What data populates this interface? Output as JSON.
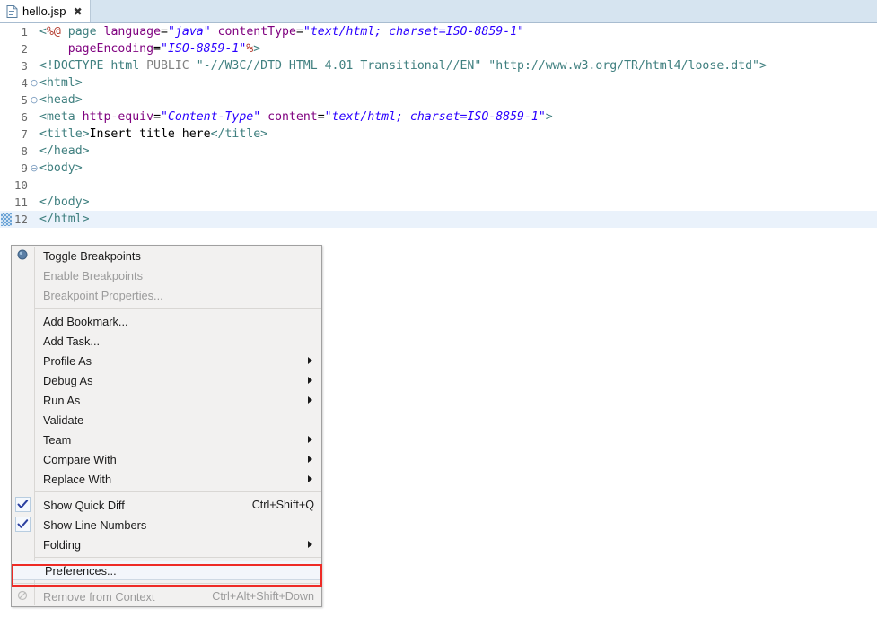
{
  "tab": {
    "filename": "hello.jsp",
    "close_glyph": "✖",
    "icon": "jsp-file-icon"
  },
  "editor": {
    "lines": [
      {
        "number": "1",
        "fold": "",
        "current": false,
        "marker": false,
        "text": "<%@ page language=\"java\" contentType=\"text/html; charset=ISO-8859-1\""
      },
      {
        "number": "2",
        "fold": "",
        "current": false,
        "marker": false,
        "text": "    pageEncoding=\"ISO-8859-1\"%>"
      },
      {
        "number": "3",
        "fold": "",
        "current": false,
        "marker": false,
        "text": "<!DOCTYPE html PUBLIC \"-//W3C//DTD HTML 4.01 Transitional//EN\" \"http://www.w3.org/TR/html4/loose.dtd\">"
      },
      {
        "number": "4",
        "fold": "⊖",
        "current": false,
        "marker": false,
        "text": "<html>"
      },
      {
        "number": "5",
        "fold": "⊖",
        "current": false,
        "marker": false,
        "text": "<head>"
      },
      {
        "number": "6",
        "fold": "",
        "current": false,
        "marker": false,
        "text": "<meta http-equiv=\"Content-Type\" content=\"text/html; charset=ISO-8859-1\">"
      },
      {
        "number": "7",
        "fold": "",
        "current": false,
        "marker": false,
        "text": "<title>Insert title here</title>"
      },
      {
        "number": "8",
        "fold": "",
        "current": false,
        "marker": false,
        "text": "</head>"
      },
      {
        "number": "9",
        "fold": "⊖",
        "current": false,
        "marker": false,
        "text": "<body>"
      },
      {
        "number": "10",
        "fold": "",
        "current": false,
        "marker": false,
        "text": ""
      },
      {
        "number": "11",
        "fold": "",
        "current": false,
        "marker": false,
        "text": "</body>"
      },
      {
        "number": "12",
        "fold": "",
        "current": true,
        "marker": true,
        "text": "</html>"
      }
    ]
  },
  "context_menu": {
    "items": [
      {
        "label": "Toggle Breakpoints",
        "accel": "",
        "type": "icon",
        "icon": "breakpoint-icon",
        "disabled": false,
        "submenu": false
      },
      {
        "label": "Enable Breakpoints",
        "accel": "",
        "type": "plain",
        "icon": "",
        "disabled": true,
        "submenu": false
      },
      {
        "label": "Breakpoint Properties...",
        "accel": "",
        "type": "plain",
        "icon": "",
        "disabled": true,
        "submenu": false
      },
      {
        "type": "separator"
      },
      {
        "label": "Add Bookmark...",
        "accel": "",
        "type": "plain",
        "icon": "",
        "disabled": false,
        "submenu": false
      },
      {
        "label": "Add Task...",
        "accel": "",
        "type": "plain",
        "icon": "",
        "disabled": false,
        "submenu": false
      },
      {
        "label": "Profile As",
        "accel": "",
        "type": "plain",
        "icon": "",
        "disabled": false,
        "submenu": true
      },
      {
        "label": "Debug As",
        "accel": "",
        "type": "plain",
        "icon": "",
        "disabled": false,
        "submenu": true
      },
      {
        "label": "Run As",
        "accel": "",
        "type": "plain",
        "icon": "",
        "disabled": false,
        "submenu": true
      },
      {
        "label": "Validate",
        "accel": "",
        "type": "plain",
        "icon": "",
        "disabled": false,
        "submenu": false
      },
      {
        "label": "Team",
        "accel": "",
        "type": "plain",
        "icon": "",
        "disabled": false,
        "submenu": true
      },
      {
        "label": "Compare With",
        "accel": "",
        "type": "plain",
        "icon": "",
        "disabled": false,
        "submenu": true
      },
      {
        "label": "Replace With",
        "accel": "",
        "type": "plain",
        "icon": "",
        "disabled": false,
        "submenu": true
      },
      {
        "type": "separator"
      },
      {
        "label": "Show Quick Diff",
        "accel": "Ctrl+Shift+Q",
        "type": "check",
        "icon": "checkmark-icon",
        "disabled": false,
        "submenu": false
      },
      {
        "label": "Show Line Numbers",
        "accel": "",
        "type": "check",
        "icon": "checkmark-icon",
        "disabled": false,
        "submenu": false
      },
      {
        "label": "Folding",
        "accel": "",
        "type": "plain",
        "icon": "",
        "disabled": false,
        "submenu": true
      },
      {
        "type": "separator"
      },
      {
        "label": "Preferences...",
        "accel": "",
        "type": "plain",
        "icon": "",
        "disabled": false,
        "submenu": false,
        "highlight": true
      },
      {
        "type": "separator-full"
      },
      {
        "label": "Remove from Context",
        "accel": "Ctrl+Alt+Shift+Down",
        "type": "icon",
        "icon": "remove-context-icon",
        "disabled": true,
        "submenu": false
      }
    ]
  },
  "annotation": {
    "highlight_color": "#ee2b26",
    "target": "Preferences..."
  }
}
